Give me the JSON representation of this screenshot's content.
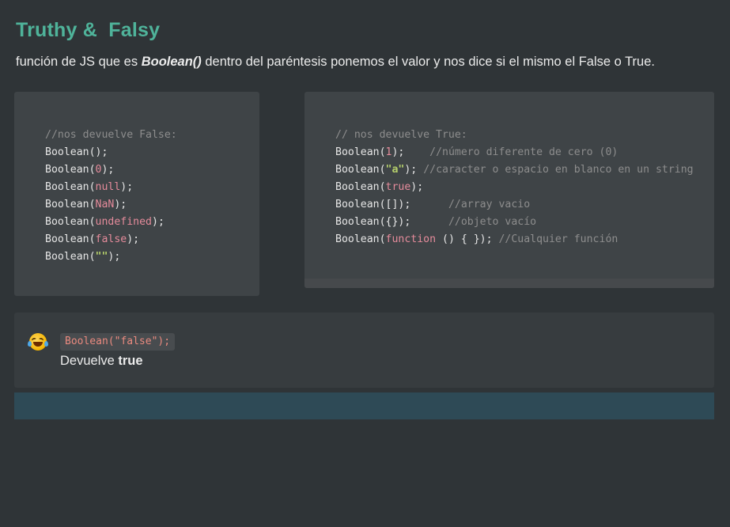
{
  "title": "Truthy &  Falsy",
  "description": {
    "before": "función de JS que es ",
    "emphasis": "Boolean()",
    "after": " dentro del paréntesis ponemos el valor y nos dice si el mismo el False o True."
  },
  "code_falsy": {
    "comment": "//nos devuelve False:",
    "lines": [
      {
        "fn": "Boolean(",
        "arg": "",
        "end": ");"
      },
      {
        "fn": "Boolean(",
        "arg": "0",
        "end": ");"
      },
      {
        "fn": "Boolean(",
        "arg": "null",
        "end": ");"
      },
      {
        "fn": "Boolean(",
        "arg": "NaN",
        "end": ");"
      },
      {
        "fn": "Boolean(",
        "arg": "undefined",
        "end": ");"
      },
      {
        "fn": "Boolean(",
        "arg": "false",
        "end": ");"
      },
      {
        "fn": "Boolean(",
        "arg": "\"\"",
        "end": ");"
      }
    ]
  },
  "code_truthy": {
    "comment": "// nos devuelve True:",
    "lines": [
      {
        "fn": "Boolean(",
        "arg": "1",
        "end": ");",
        "gap": "    ",
        "comment": "//número diferente de cero (0)"
      },
      {
        "fn": "Boolean(",
        "arg": "\"a\"",
        "end": ");",
        "gap": " ",
        "comment": "//caracter o espacio en blanco en un string"
      },
      {
        "fn": "Boolean(",
        "arg": "true",
        "end": ");",
        "gap": "",
        "comment": ""
      },
      {
        "fn": "Boolean(",
        "arg": "[]",
        "end": ");",
        "gap": "      ",
        "comment": "//array vacio"
      },
      {
        "fn": "Boolean(",
        "arg": "{}",
        "end": ");",
        "gap": "      ",
        "comment": "//objeto vacío"
      },
      {
        "fn": "Boolean(",
        "arg": "function",
        "end": " () { }); ",
        "gap": "",
        "comment": "//Cualquier función"
      }
    ]
  },
  "callout": {
    "icon": "rolling-on-floor-laughing-emoji",
    "code": "Boolean(\"false\");",
    "text_before": "Devuelve ",
    "text_strong": "true"
  },
  "colors": {
    "title": "#4fb39a",
    "background": "#2f3437",
    "code_block": "#3f4447",
    "callout": "#373c3f",
    "bottom_bar": "#2e4a56",
    "comment": "#8d8d8d",
    "number_keyword": "#e58b9b",
    "string": "#b5cf6b",
    "inline_code": "#ea8a7f"
  }
}
